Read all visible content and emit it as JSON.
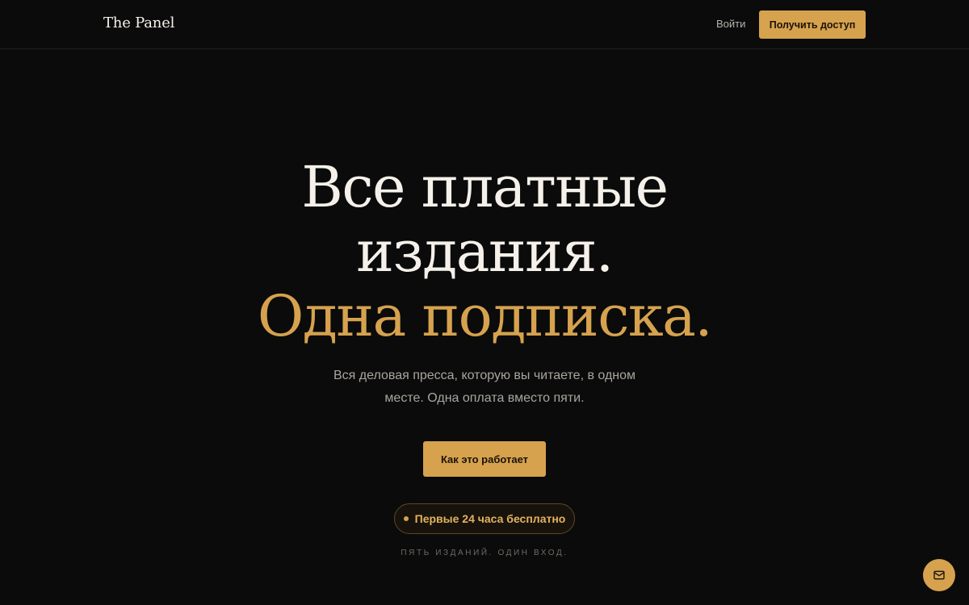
{
  "header": {
    "brand": "The Panel",
    "login_label": "Войти",
    "cta_label": "Получить доступ"
  },
  "hero": {
    "title_line1": "Все платные",
    "title_line2": "издания.",
    "title_line3": "Одна подписка.",
    "subtitle": "Вся деловая пресса, которую вы читаете, в одном месте. Одна оплата вместо пяти.",
    "cta_label": "Как это работает",
    "badge_text": "Первые 24 часа бесплатно",
    "tagline": "ПЯТЬ ИЗДАНИЙ. ОДИН ВХОД."
  },
  "chat": {
    "icon": "mail-icon"
  },
  "colors": {
    "background": "#0b0b0b",
    "accent": "#d6a24e",
    "text": "#f5f1ea",
    "muted": "#a9a59f"
  }
}
